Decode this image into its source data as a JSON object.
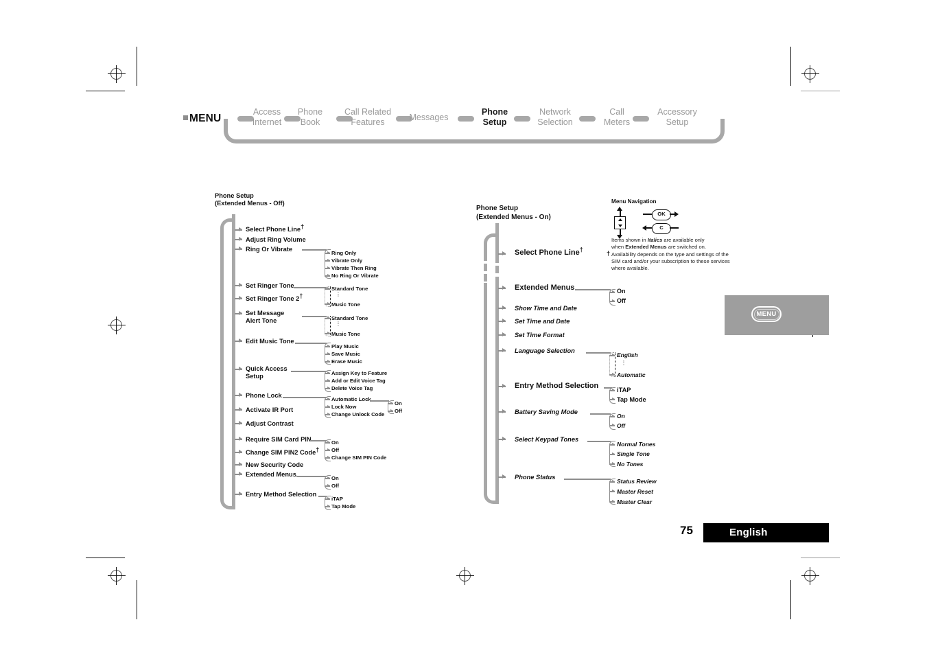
{
  "page": {
    "number": "75",
    "language_bar": "English",
    "menu_key_label": "MENU"
  },
  "topnav": {
    "menu_label": "MENU",
    "items": [
      {
        "label": "Access\nInternet",
        "line1": "Access",
        "line2": "Internet",
        "bold": false
      },
      {
        "label": "Phone\nBook",
        "line1": "Phone",
        "line2": "Book",
        "bold": false
      },
      {
        "label": "Call Related\nFeatures",
        "line1": "Call Related",
        "line2": "Features",
        "bold": false
      },
      {
        "label": "Messages",
        "line1": "Messages",
        "line2": "",
        "bold": false
      },
      {
        "label": "Phone\nSetup",
        "line1": "Phone",
        "line2": "Setup",
        "bold": true
      },
      {
        "label": "Network\nSelection",
        "line1": "Network",
        "line2": "Selection",
        "bold": false
      },
      {
        "label": "Call\nMeters",
        "line1": "Call",
        "line2": "Meters",
        "bold": false
      },
      {
        "label": "Accessory\nSetup",
        "line1": "Accessory",
        "line2": "Setup",
        "bold": false
      }
    ]
  },
  "left_tree": {
    "title_line1": "Phone Setup",
    "title_line2": "(Extended Menus - Off)",
    "items": [
      {
        "label": "Select Phone Line",
        "dagger": true,
        "italic": false,
        "subs": []
      },
      {
        "label": "Adjust Ring Volume",
        "dagger": false,
        "italic": false,
        "subs": []
      },
      {
        "label": "Ring Or Vibrate",
        "dagger": false,
        "italic": false,
        "subs": [
          "Ring Only",
          "Vibrate Only",
          "Vibrate Then Ring",
          "No Ring Or Vibrate"
        ]
      },
      {
        "label": "Set Ringer Tone",
        "dagger": false,
        "italic": false,
        "subs": [
          "Standard Tone",
          "⋮",
          "Music Tone"
        ]
      },
      {
        "label": "Set Ringer Tone 2",
        "dagger": true,
        "italic": false,
        "subs": []
      },
      {
        "label": "Set Message\nAlert Tone",
        "line1": "Set Message",
        "line2": "Alert Tone",
        "dagger": false,
        "italic": false,
        "subs": [
          "Standard Tone",
          "⋮",
          "Music Tone"
        ]
      },
      {
        "label": "Edit Music Tone",
        "dagger": false,
        "italic": false,
        "subs": [
          "Play Music",
          "Save Music",
          "Erase Music"
        ]
      },
      {
        "label": "Quick Access\nSetup",
        "line1": "Quick Access",
        "line2": "Setup",
        "dagger": false,
        "italic": false,
        "subs": [
          "Assign Key to Feature",
          "Add or Edit Voice Tag",
          "Delete Voice Tag"
        ]
      },
      {
        "label": "Phone Lock",
        "dagger": false,
        "italic": false,
        "subs": [
          "Automatic Lock",
          "Lock Now",
          "Change Unlock Code"
        ],
        "subsubs": [
          "On",
          "Off"
        ]
      },
      {
        "label": "Activate IR Port",
        "dagger": false,
        "italic": false,
        "subs": []
      },
      {
        "label": "Adjust Contrast",
        "dagger": false,
        "italic": false,
        "subs": []
      },
      {
        "label": "Require SIM Card PIN",
        "dagger": false,
        "italic": false,
        "subs": [
          "On",
          "Off",
          "Change SIM PIN Code"
        ]
      },
      {
        "label": "Change SIM PIN2 Code",
        "dagger": true,
        "italic": false,
        "subs": []
      },
      {
        "label": "New Security Code",
        "dagger": false,
        "italic": false,
        "subs": []
      },
      {
        "label": "Extended Menus",
        "dagger": false,
        "italic": false,
        "subs": [
          "On",
          "Off"
        ]
      },
      {
        "label": "Entry Method Selection",
        "dagger": false,
        "italic": false,
        "subs": [
          "iTAP",
          "Tap Mode"
        ]
      }
    ]
  },
  "right_tree": {
    "title_line1": "Phone Setup",
    "title_line2": "(Extended Menus - On)",
    "items": [
      {
        "label": "Select Phone Line",
        "dagger": true,
        "italic": false,
        "subs": []
      },
      {
        "label": "Extended Menus",
        "dagger": false,
        "italic": false,
        "subs": [
          "On",
          "Off"
        ]
      },
      {
        "label": "Show Time and Date",
        "dagger": false,
        "italic": true,
        "subs": []
      },
      {
        "label": "Set Time and Date",
        "dagger": false,
        "italic": true,
        "subs": []
      },
      {
        "label": "Set Time Format",
        "dagger": false,
        "italic": true,
        "subs": []
      },
      {
        "label": "Language Selection",
        "dagger": false,
        "italic": true,
        "subs": [
          "English",
          "⋮",
          "Automatic"
        ]
      },
      {
        "label": "Entry Method Selection",
        "dagger": false,
        "italic": false,
        "subs": [
          "iTAP",
          "Tap Mode"
        ]
      },
      {
        "label": "Battery Saving Mode",
        "dagger": false,
        "italic": true,
        "subs": [
          "On",
          "Off"
        ]
      },
      {
        "label": "Select Keypad Tones",
        "dagger": false,
        "italic": true,
        "subs": [
          "Normal Tones",
          "Single Tone",
          "No Tones"
        ]
      },
      {
        "label": "Phone Status",
        "dagger": false,
        "italic": true,
        "subs": [
          "Status Review",
          "Master Reset",
          "Master Clear"
        ]
      }
    ]
  },
  "legend": {
    "title": "Menu Navigation",
    "ok_key": "OK",
    "clear_key": "C",
    "note_line1_a": "Items shown in ",
    "note_line1_b": "Italics",
    "note_line1_c": " are available only",
    "note_line2_a": "when ",
    "note_line2_b": "Extended Menus",
    "note_line2_c": " are switched on.",
    "dagger_symbol": "†",
    "note_line3": "Availability depends on the type and settings of the",
    "note_line4": "SIM card and/or your subscription to these services",
    "note_line5": "where available."
  }
}
